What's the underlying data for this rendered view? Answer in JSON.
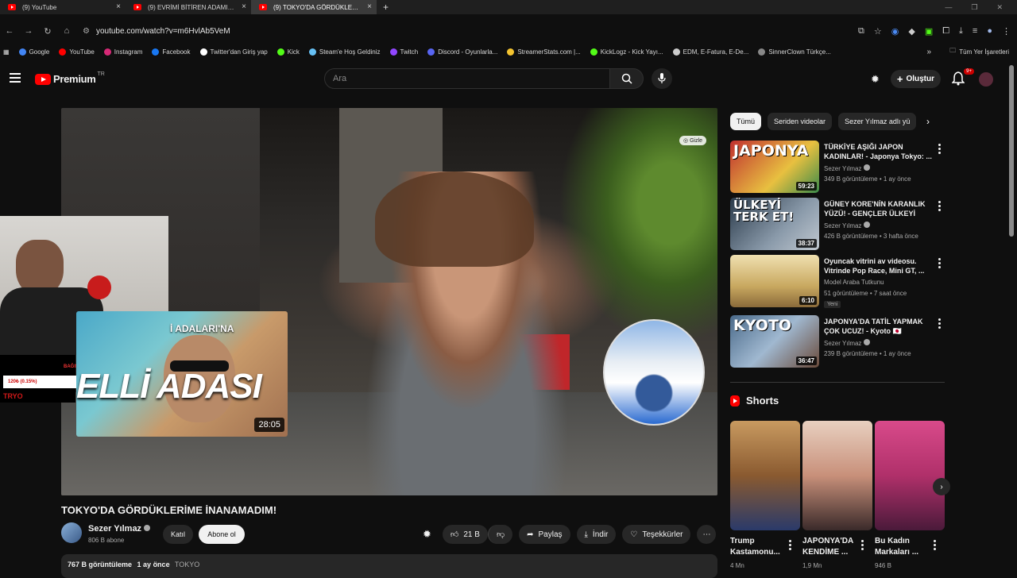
{
  "browser": {
    "tabs": [
      {
        "title": "(9) YouTube",
        "active": false
      },
      {
        "title": "(9) EVRİMİ BİTİREN ADAMI BİTİ",
        "active": false
      },
      {
        "title": "(9) TOKYO'DA GÖRDÜKLERİME",
        "active": true
      }
    ],
    "url": "youtube.com/watch?v=m6HvlAb5VeM",
    "bookmarks": [
      {
        "label": "Google",
        "color": "#4285f4"
      },
      {
        "label": "YouTube",
        "color": "#ff0000"
      },
      {
        "label": "Instagram",
        "color": "#d62976"
      },
      {
        "label": "Facebook",
        "color": "#1877f2"
      },
      {
        "label": "Twitter'dan Giriş yap",
        "color": "#ffffff"
      },
      {
        "label": "Kick",
        "color": "#53fc18"
      },
      {
        "label": "Steam'e Hoş Geldiniz",
        "color": "#66c0f4"
      },
      {
        "label": "Twitch",
        "color": "#9146ff"
      },
      {
        "label": "Discord - Oyunlarla...",
        "color": "#5865f2"
      },
      {
        "label": "StreamerStats.com |...",
        "color": "#f4c430"
      },
      {
        "label": "KickLogz - Kick Yayı...",
        "color": "#53fc18"
      },
      {
        "label": "EDM, E-Fatura, E-De...",
        "color": "#cccccc"
      },
      {
        "label": "SinnerClown Türkçe...",
        "color": "#888888"
      }
    ],
    "all_bookmarks_label": "Tüm Yer İşaretleri"
  },
  "youtube": {
    "logo_word": "Premium",
    "logo_region": "TR",
    "search_placeholder": "Ara",
    "create_label": "Oluştur",
    "notif_count": "9+"
  },
  "video": {
    "title": "TOKYO'DA GÖRDÜKLERİME İNANAMADIM!",
    "hide_label": "Gizle",
    "endcard": {
      "title_top": "İ ADALARI'NA",
      "title_big": "ELLİ ADASI",
      "duration": "28:05"
    },
    "overlay": {
      "bar_text": "120₺ (0.15%)",
      "label": "TRYO",
      "small": "BAĞIŞ DESTEK"
    },
    "channel": {
      "name": "Sezer Yılmaz",
      "subs": "806 B abone"
    },
    "join_label": "Katıl",
    "subscribe_label": "Abone ol",
    "likes": "21 B",
    "share_label": "Paylaş",
    "download_label": "İndir",
    "thanks_label": "Teşekkürler",
    "views": "767 B görüntüleme",
    "age": "1 ay önce",
    "tag": "TOKYO"
  },
  "chips": [
    "Tümü",
    "Seriden videolar",
    "Sezer Yılmaz adlı yü"
  ],
  "recommendations": [
    {
      "title": "TÜRKİYE AŞIĞI JAPON KADINLAR! - Japonya Tokyo: ...",
      "channel": "Sezer Yılmaz",
      "meta": "349 B görüntüleme • 1 ay önce",
      "duration": "59:23",
      "thumb_text": "JAPONYA",
      "thumb_color": "#c03030",
      "badge": ""
    },
    {
      "title": "GÜNEY KORE'NİN KARANLIK YÜZÜ! - GENÇLER ÜLKEYİ TER...",
      "channel": "Sezer Yılmaz",
      "meta": "426 B görüntüleme • 3 hafta önce",
      "duration": "38:37",
      "thumb_text": "ÜLKEYİ TERK ET!",
      "thumb_color": "#3a4a5a",
      "badge": ""
    },
    {
      "title": "Oyuncak vitrini av videosu. Vitrinde Pop Race, Mini GT, ...",
      "channel": "Model Araba Tutkunu",
      "meta": "51 görüntüleme • 7 saat önce",
      "duration": "6:10",
      "thumb_text": "",
      "thumb_color": "#c8a860",
      "badge": "Yeni"
    },
    {
      "title": "JAPONYA'DA TATİL YAPMAK ÇOK UCUZ! - Kyoto 🇯🇵",
      "channel": "Sezer Yılmaz",
      "meta": "239 B görüntüleme • 1 ay önce",
      "duration": "36:47",
      "thumb_text": "KYOTO",
      "thumb_color": "#5a7a9a",
      "badge": ""
    }
  ],
  "shorts": {
    "heading": "Shorts",
    "items": [
      {
        "caption": "Trump Kastamonu...",
        "views": "4 Mn",
        "color": "#b87a40"
      },
      {
        "caption": "JAPONYA'DA KENDİME ...",
        "views": "1,9 Mn",
        "color": "#d8a890"
      },
      {
        "caption": "Bu Kadın Markaları ...",
        "views": "946 B",
        "color": "#b0306a"
      }
    ]
  }
}
